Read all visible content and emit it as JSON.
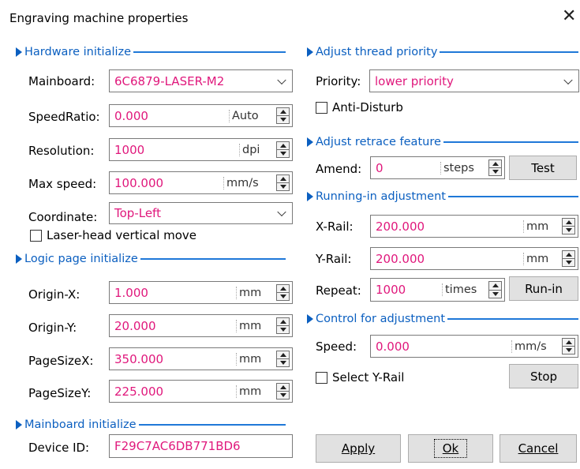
{
  "window": {
    "title": "Engraving machine properties",
    "close_glyph": "✕"
  },
  "hardware": {
    "section": "Hardware initialize",
    "mainboard_label": "Mainboard:",
    "mainboard_value": "6C6879-LASER-M2",
    "speedratio_label": "SpeedRatio:",
    "speedratio_value": "0.000",
    "speedratio_unit": "Auto",
    "resolution_label": "Resolution:",
    "resolution_value": "1000",
    "resolution_unit": "dpi",
    "maxspeed_label": "Max speed:",
    "maxspeed_value": "100.000",
    "maxspeed_unit": "mm/s",
    "coordinate_label": "Coordinate:",
    "coordinate_value": "Top-Left",
    "laserhead_label": "Laser-head vertical move"
  },
  "logic": {
    "section": "Logic page initialize",
    "originx_label": "Origin-X:",
    "originx_value": "1.000",
    "originx_unit": "mm",
    "originy_label": "Origin-Y:",
    "originy_value": "20.000",
    "originy_unit": "mm",
    "pagesizex_label": "PageSizeX:",
    "pagesizex_value": "350.000",
    "pagesizex_unit": "mm",
    "pagesizey_label": "PageSizeY:",
    "pagesizey_value": "225.000",
    "pagesizey_unit": "mm"
  },
  "mainboard": {
    "section": "Mainboard initialize",
    "deviceid_label": "Device ID:",
    "deviceid_value": "F29C7AC6DB771BD6"
  },
  "thread": {
    "section": "Adjust thread priority",
    "priority_label": "Priority:",
    "priority_value": "lower priority",
    "antidisturb_label": "Anti-Disturb"
  },
  "retrace": {
    "section": "Adjust retrace feature",
    "amend_label": "Amend:",
    "amend_value": "0",
    "amend_unit": "steps",
    "test_label": "Test"
  },
  "runin": {
    "section": "Running-in adjustment",
    "xrail_label": "X-Rail:",
    "xrail_value": "200.000",
    "xrail_unit": "mm",
    "yrail_label": "Y-Rail:",
    "yrail_value": "200.000",
    "yrail_unit": "mm",
    "repeat_label": "Repeat:",
    "repeat_value": "1000",
    "repeat_unit": "times",
    "runin_label": "Run-in"
  },
  "control": {
    "section": "Control for adjustment",
    "speed_label": "Speed:",
    "speed_value": "0.000",
    "speed_unit": "mm/s",
    "selectyrail_label": "Select Y-Rail",
    "stop_label": "Stop"
  },
  "footer": {
    "apply_label": "Apply",
    "ok_label": "Ok",
    "cancel_label": "Cancel"
  },
  "colors": {
    "section_blue": "#0b5fc0",
    "value_pink": "#e0187c"
  }
}
